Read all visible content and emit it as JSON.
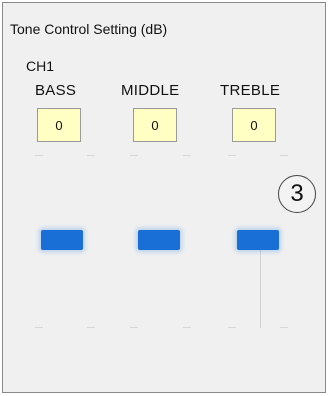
{
  "title": "Tone Control Setting (dB)",
  "channel": "CH1",
  "bands": [
    {
      "label": "BASS",
      "value": "0"
    },
    {
      "label": "MIDDLE",
      "value": "0"
    },
    {
      "label": "TREBLE",
      "value": "0"
    }
  ],
  "callout": "3",
  "colors": {
    "slider": "#1a6fd6",
    "value_box": "#ffffc4",
    "panel_bg": "#f0f0f0"
  }
}
